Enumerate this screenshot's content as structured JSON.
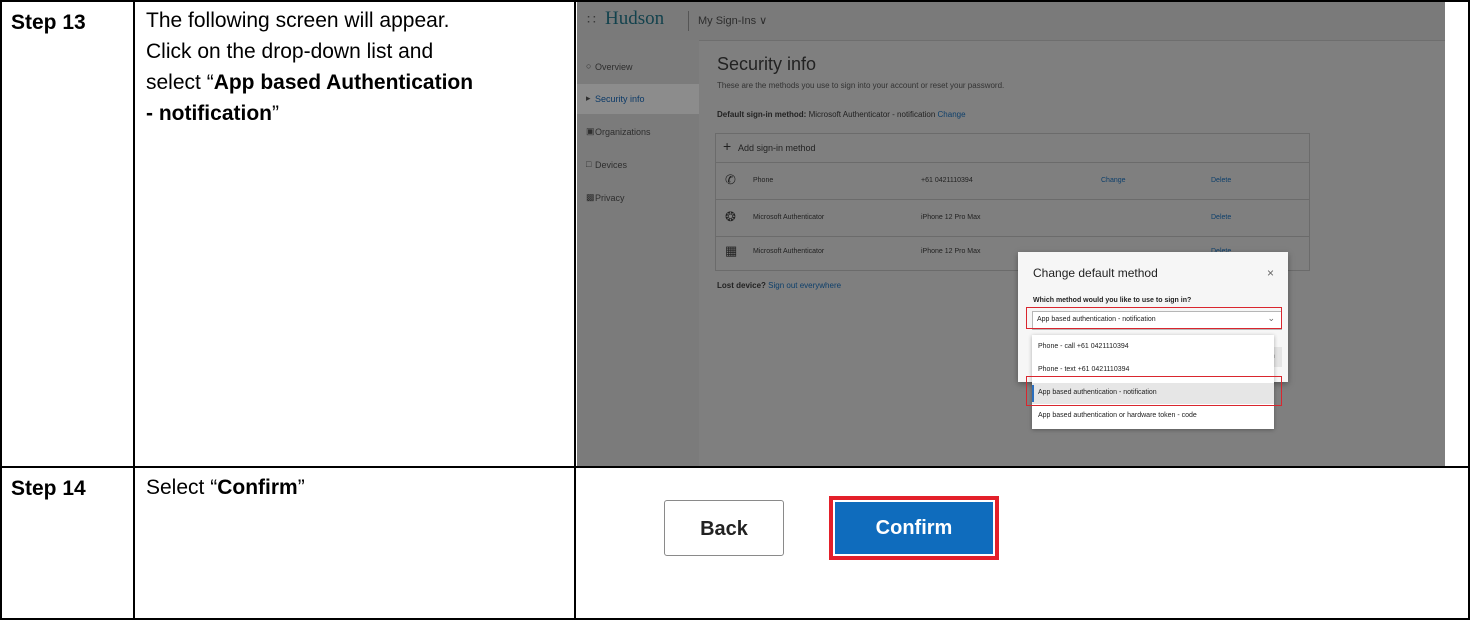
{
  "step13": {
    "label": "Step 13",
    "text_lines": [
      "The following screen will appear.",
      "Click on the drop-down list and"
    ],
    "select_prefix": "select “",
    "bold_1": "App based Authentication",
    "bold_2": "- notification",
    "close_quote": "”"
  },
  "step14": {
    "label": "Step 14",
    "text_prefix": "Select “",
    "bold": "Confirm",
    "close_quote": "”"
  },
  "screenshot": {
    "header": {
      "brand": "Hudson",
      "app_menu": "My Sign-Ins ∨"
    },
    "nav": [
      {
        "icon": "overview-icon",
        "label": "Overview"
      },
      {
        "icon": "security-icon",
        "label": "Security info"
      },
      {
        "icon": "organizations-icon",
        "label": "Organizations"
      },
      {
        "icon": "devices-icon",
        "label": "Devices"
      },
      {
        "icon": "privacy-icon",
        "label": "Privacy"
      }
    ],
    "title": "Security info",
    "subtitle": "These are the methods you use to sign into your account or reset your password.",
    "default_method_label": "Default sign-in method:",
    "default_method_value": "Microsoft Authenticator - notification",
    "default_method_change": "Change",
    "add_method": "Add sign-in method",
    "methods": [
      {
        "icon": "phone-icon",
        "name": "Phone",
        "detail": "+61 0421110394",
        "change": "Change",
        "delete": "Delete"
      },
      {
        "icon": "authenticator-icon",
        "name": "Microsoft Authenticator",
        "detail": "iPhone 12 Pro Max",
        "change": "",
        "delete": "Delete"
      },
      {
        "icon": "authenticator-passwordless-icon",
        "name": "Microsoft Authenticator",
        "detail": "iPhone 12 Pro Max",
        "change": "",
        "delete": "Delete"
      }
    ],
    "lost_device_label": "Lost device?",
    "lost_device_link": "Sign out everywhere",
    "dialog": {
      "title": "Change default method",
      "close": "×",
      "question": "Which method would you like to use to sign in?",
      "selected_value": "App based authentication - notification",
      "hidden_button_peek": "irm",
      "options": [
        "Phone - call +61 0421110394",
        "Phone - text +61 0421110394",
        "App based authentication - notification",
        "App based authentication or hardware token - code"
      ],
      "selected_index": 2
    }
  },
  "buttons": {
    "back": "Back",
    "confirm": "Confirm"
  },
  "colors": {
    "highlight": "#e3202a",
    "primary": "#0f6cbd"
  }
}
